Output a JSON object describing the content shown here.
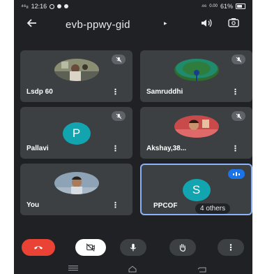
{
  "status_bar": {
    "carrier": "⁴⁶ₗₗ",
    "time": "12:16",
    "network": "⁴⁶",
    "speed": "0.00",
    "battery": "61%"
  },
  "header": {
    "meeting_code": "evb-ppwy-gid",
    "caret": "▸",
    "back_icon": "arrow-left-icon",
    "speaker_icon": "speaker-icon",
    "switch_camera_icon": "switch-camera-icon"
  },
  "participants": [
    {
      "name": "Lsdp 60",
      "avatar": "photo",
      "muted": true
    },
    {
      "name": "Samruddhi",
      "avatar": "photo",
      "muted": true
    },
    {
      "name": "Pallavi",
      "avatar": "letter",
      "letter": "P",
      "color": "#12a4af",
      "muted": true
    },
    {
      "name": "Akshay,38...",
      "avatar": "photo",
      "muted": true
    },
    {
      "name": "You",
      "avatar": "photo",
      "muted": false
    },
    {
      "name": "PPCOF",
      "avatar": "letter",
      "letter": "S",
      "color": "#12a4af",
      "muted": false,
      "speaking": true,
      "overlay": "4 others"
    }
  ],
  "more_glyph": "⋮",
  "controls": {
    "end_call_color": "#ea4335",
    "camera_off_bg": "#ffffff",
    "control_bg": "#3c4043",
    "more_label": "⋮"
  },
  "colors": {
    "background": "#202124",
    "tile": "#3c4043",
    "accent": "#1a73e8"
  }
}
